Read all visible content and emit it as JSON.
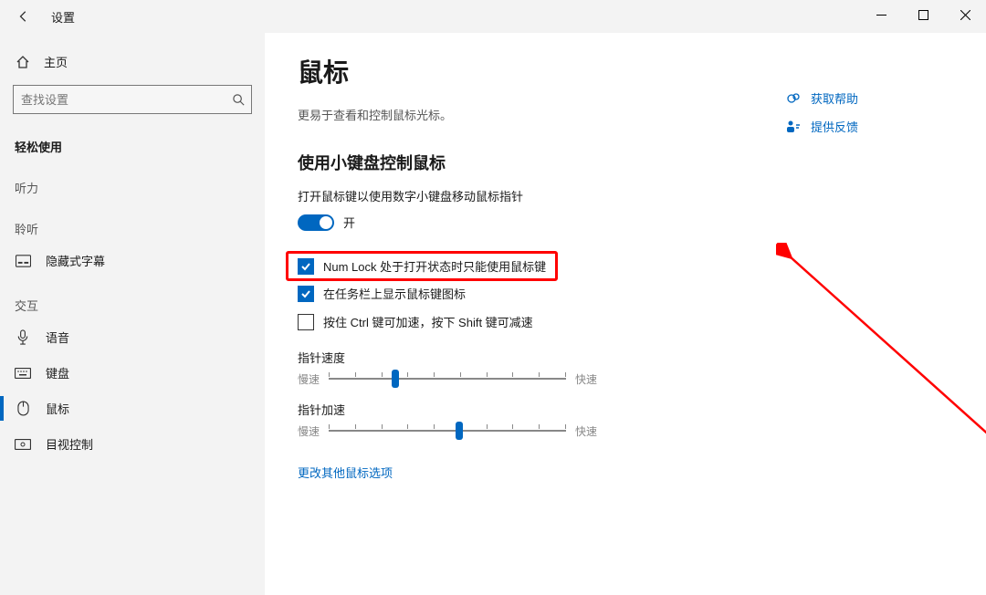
{
  "titlebar": {
    "app": "设置"
  },
  "sidebar": {
    "home": "主页",
    "search_placeholder": "查找设置",
    "category": "轻松使用",
    "groups": {
      "hearing": "听力",
      "listen": "聆听",
      "interact": "交互"
    },
    "items": {
      "transcript": "隐藏式字幕",
      "voice": "语音",
      "keyboard": "键盘",
      "mouse": "鼠标",
      "eyecontrol": "目视控制"
    }
  },
  "main": {
    "title": "鼠标",
    "subtitle": "更易于查看和控制鼠标光标。",
    "section_title": "使用小键盘控制鼠标",
    "toggle_desc": "打开鼠标键以使用数字小键盘移动鼠标指针",
    "toggle_state": "开",
    "checks": {
      "numlock": "Num Lock 处于打开状态时只能使用鼠标键",
      "taskbar": "在任务栏上显示鼠标键图标",
      "ctrlshift": "按住 Ctrl 键可加速，按下 Shift 键可减速"
    },
    "speed_label": "指针速度",
    "accel_label": "指针加速",
    "slow": "慢速",
    "fast": "快速",
    "more_link": "更改其他鼠标选项"
  },
  "side": {
    "help": "获取帮助",
    "feedback": "提供反馈"
  }
}
